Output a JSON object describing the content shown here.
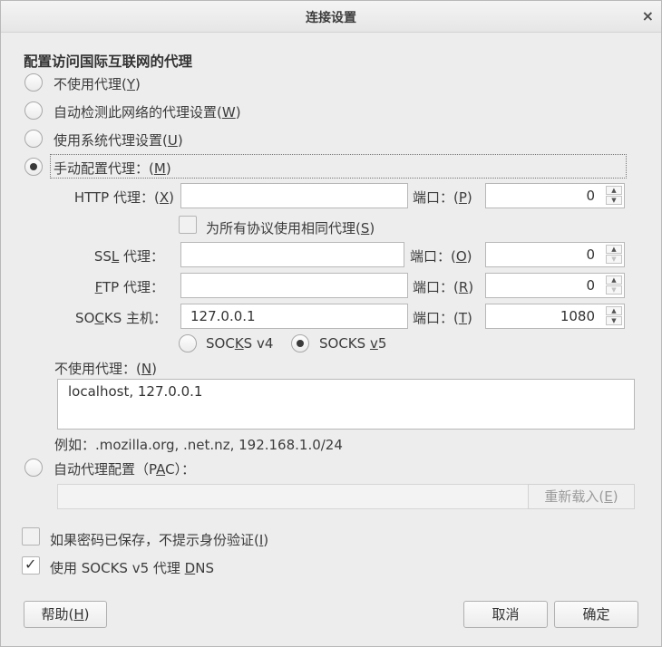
{
  "window": {
    "title": "连接设置",
    "close": "×"
  },
  "group_title": "配置访问国际互联网的代理",
  "proxy_options": [
    {
      "text": "不使用代理(",
      "key": "Y",
      "end": ")",
      "checked": false
    },
    {
      "text": "自动检测此网络的代理设置(",
      "key": "W",
      "end": ")",
      "checked": false
    },
    {
      "text": "使用系统代理设置(",
      "key": "U",
      "end": ")",
      "checked": false
    },
    {
      "text": "手动配置代理：(",
      "key": "M",
      "end": ")",
      "checked": true
    }
  ],
  "http": {
    "pre": "HTTP 代理：(",
    "key": "X",
    "end": ")",
    "value": "",
    "port_pre": "端口：(",
    "port_key": "P",
    "port_end": ")",
    "port": "0"
  },
  "same_proxy": {
    "pre": "为所有协议使用相同代理(",
    "key": "S",
    "end": ")",
    "checked": false
  },
  "ssl": {
    "pre": "SS",
    "key": "L",
    "end": " 代理：",
    "value": "",
    "port_pre": "端口：(",
    "port_key": "O",
    "port_end": ")",
    "port": "0"
  },
  "ftp": {
    "pre": "",
    "key": "F",
    "end": "TP 代理：",
    "value": "",
    "port_pre": "端口：(",
    "port_key": "R",
    "port_end": ")",
    "port": "0"
  },
  "socks": {
    "pre": "SO",
    "key": "C",
    "end": "KS 主机：",
    "value": "127.0.0.1",
    "port_pre": "端口：(",
    "port_key": "T",
    "port_end": ")",
    "port": "1080"
  },
  "socks_versions": [
    {
      "pre": "SOC",
      "key": "K",
      "end": "S v4",
      "checked": false
    },
    {
      "pre": "SOCKS ",
      "key": "v",
      "end": "5",
      "checked": true
    }
  ],
  "no_proxy": {
    "pre": "不使用代理：(",
    "key": "N",
    "end": ")",
    "value": "localhost, 127.0.0.1",
    "example": "例如：.mozilla.org, .net.nz, 192.168.1.0/24"
  },
  "pac": {
    "pre": "自动代理配置（P",
    "key": "A",
    "end": "C）：",
    "checked": false,
    "url": "",
    "reload_pre": "重新载入(",
    "reload_key": "E",
    "reload_end": ")"
  },
  "no_auth_prompt": {
    "pre": "如果密码已保存，不提示身份验证(",
    "key": "I",
    "end": ")",
    "checked": false
  },
  "socks_dns": {
    "pre": "使用 SOCKS v5 代理 ",
    "key": "D",
    "end": "NS",
    "checked": true
  },
  "buttons": {
    "help_pre": "帮助(",
    "help_key": "H",
    "help_end": ")",
    "cancel": "取消",
    "ok": "确定"
  }
}
